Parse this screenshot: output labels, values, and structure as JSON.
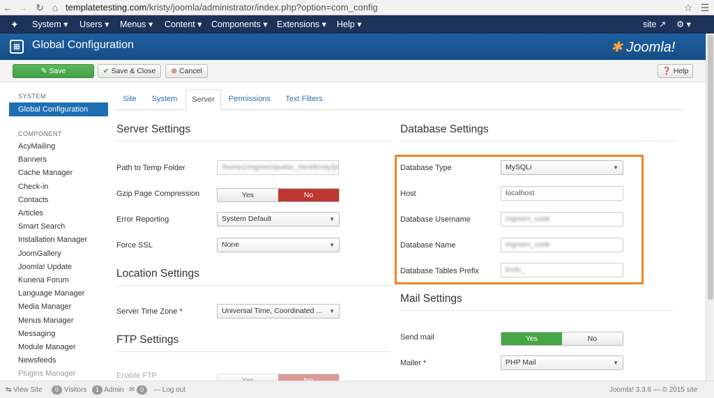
{
  "browser": {
    "url_domain": "templatetesting.com",
    "url_path": "/kristy/joomla/administrator/index.php?option=com_config"
  },
  "nav": {
    "items": [
      "System",
      "Users",
      "Menus",
      "Content",
      "Components",
      "Extensions",
      "Help"
    ],
    "site_link": "site"
  },
  "header": {
    "title": "Global Configuration",
    "logo_text": "Joomla!"
  },
  "toolbar": {
    "save": "Save",
    "save_close": "Save & Close",
    "cancel": "Cancel",
    "help": "Help"
  },
  "sidebar": {
    "system_heading": "SYSTEM",
    "active_item": "Global Configuration",
    "component_heading": "COMPONENT",
    "items": [
      "AcyMailing",
      "Banners",
      "Cache Manager",
      "Check-in",
      "Contacts",
      "Articles",
      "Smart Search",
      "Installation Manager",
      "JoomGallery",
      "Joomla! Update",
      "Kunena Forum",
      "Language Manager",
      "Media Manager",
      "Menus Manager",
      "Messaging",
      "Module Manager",
      "Newsfeeds",
      "Plugins Manager"
    ]
  },
  "tabs": [
    "Site",
    "System",
    "Server",
    "Permissions",
    "Text Filters"
  ],
  "server": {
    "heading": "Server Settings",
    "temp_label": "Path to Temp Folder",
    "temp_value": "/home1/mgreen/public_html/kristy/joomla/tmp",
    "gzip_label": "Gzip Page Compression",
    "gzip_yes": "Yes",
    "gzip_no": "No",
    "error_label": "Error Reporting",
    "error_value": "System Default",
    "ssl_label": "Force SSL",
    "ssl_value": "None"
  },
  "location": {
    "heading": "Location Settings",
    "tz_label": "Server Time Zone *",
    "tz_value": "Universal Time, Coordinated ..."
  },
  "ftp": {
    "heading": "FTP Settings",
    "enable_label": "Enable FTP",
    "yes": "Yes",
    "no": "No"
  },
  "database": {
    "heading": "Database Settings",
    "type_label": "Database Type",
    "type_value": "MySQLi",
    "host_label": "Host",
    "host_value": "localhost",
    "user_label": "Database Username",
    "user_value": "mgreen_cook",
    "name_label": "Database Name",
    "name_value": "mgreen_cook",
    "prefix_label": "Database Tables Prefix",
    "prefix_value": "lcrdv_"
  },
  "mail": {
    "heading": "Mail Settings",
    "send_label": "Send mail",
    "send_yes": "Yes",
    "send_no": "No",
    "mailer_label": "Mailer *",
    "mailer_value": "PHP Mail"
  },
  "status": {
    "view_site": "View Site",
    "visitors_count": "0",
    "visitors": "Visitors",
    "admin_count": "1",
    "admin": "Admin",
    "msg_count": "0",
    "logout": "Log out",
    "version": "Joomla! 3.3.6 — © 2015 site"
  }
}
